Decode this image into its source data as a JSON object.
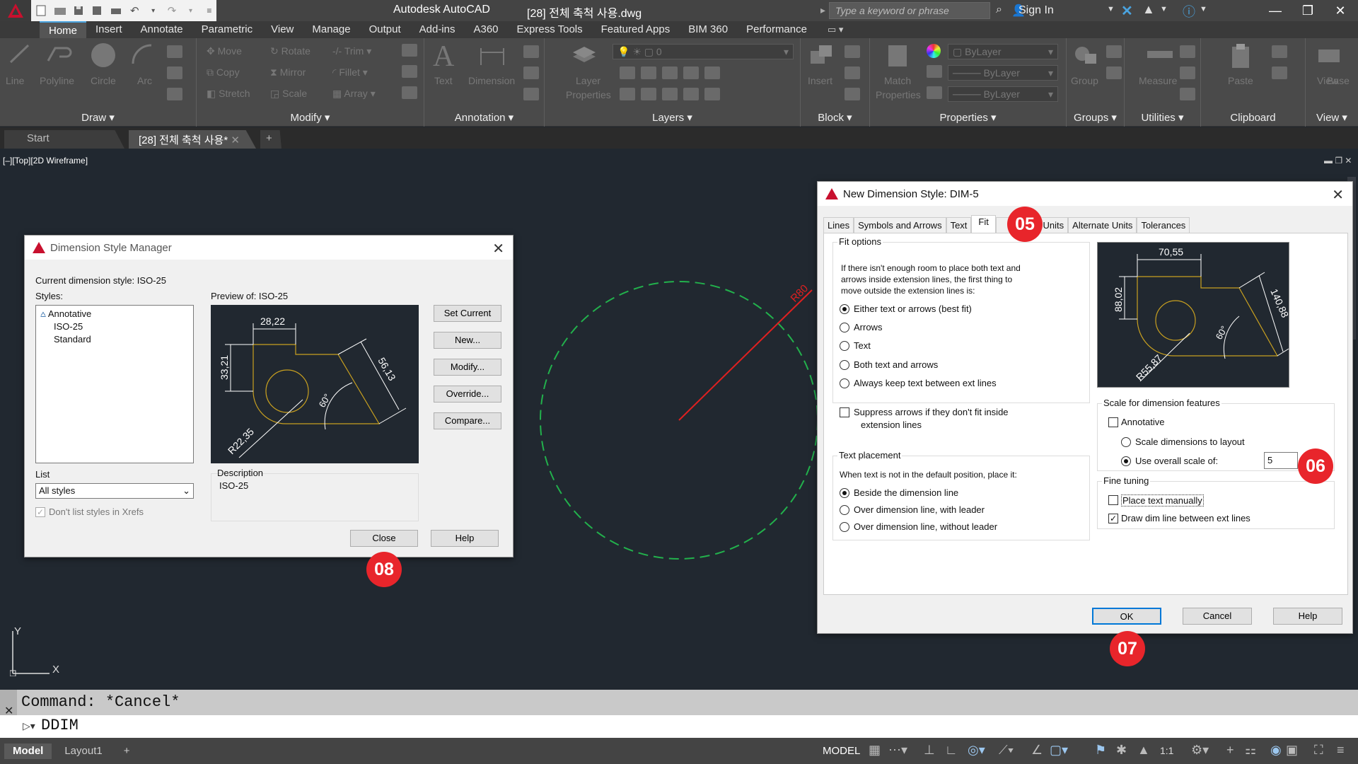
{
  "titlebar": {
    "app_name": "Autodesk AutoCAD",
    "file_name": "[28] 전체 축척 사용.dwg",
    "search_placeholder": "Type a keyword or phrase",
    "sign_in": "Sign In"
  },
  "ribbon_tabs": [
    "Home",
    "Insert",
    "Annotate",
    "Parametric",
    "View",
    "Manage",
    "Output",
    "Add-ins",
    "A360",
    "Express Tools",
    "Featured Apps",
    "BIM 360",
    "Performance"
  ],
  "ribbon": {
    "draw": {
      "title": "Draw",
      "line": "Line",
      "polyline": "Polyline",
      "circle": "Circle",
      "arc": "Arc"
    },
    "modify": {
      "title": "Modify",
      "move": "Move",
      "rotate": "Rotate",
      "trim": "Trim",
      "copy": "Copy",
      "mirror": "Mirror",
      "fillet": "Fillet",
      "stretch": "Stretch",
      "scale": "Scale",
      "array": "Array"
    },
    "annotation": {
      "title": "Annotation",
      "text": "Text",
      "dimension": "Dimension"
    },
    "layers": {
      "title": "Layers",
      "layer_properties_1": "Layer",
      "layer_properties_2": "Properties",
      "current_layer": "0"
    },
    "block": {
      "title": "Block",
      "insert": "Insert"
    },
    "properties": {
      "title": "Properties",
      "match_1": "Match",
      "match_2": "Properties",
      "color": "ByLayer",
      "linetype": "ByLayer",
      "lineweight": "ByLayer"
    },
    "groups": {
      "title": "Groups",
      "group": "Group"
    },
    "utilities": {
      "title": "Utilities",
      "measure": "Measure"
    },
    "clipboard": {
      "title": "Clipboard",
      "paste": "Paste"
    },
    "view": {
      "title": "View",
      "base": "Base"
    }
  },
  "doc_tabs": {
    "start": "Start",
    "active": "[28] 전체 축척 사용*"
  },
  "viewport": {
    "label": "[–][Top][2D Wireframe]",
    "radius_label": "R80",
    "axis_y": "Y",
    "axis_x": "X"
  },
  "dsm": {
    "title": "Dimension Style Manager",
    "current": "Current dimension style: ISO-25",
    "styles_label": "Styles:",
    "styles": [
      "Annotative",
      "ISO-25",
      "Standard"
    ],
    "preview_label": "Preview of: ISO-25",
    "preview": {
      "d1": "28,22",
      "d2": "33,21",
      "d3": "56,13",
      "angle": "60°",
      "radius": "R22,35"
    },
    "buttons": {
      "set_current": "Set Current",
      "new": "New...",
      "modify": "Modify...",
      "override": "Override...",
      "compare": "Compare...",
      "close": "Close",
      "help": "Help"
    },
    "list_label": "List",
    "list_value": "All styles",
    "xrefs": "Don't list styles in Xrefs",
    "description_label": "Description",
    "description_value": "ISO-25"
  },
  "nds": {
    "title": "New Dimension Style: DIM-5",
    "tabs": [
      "Lines",
      "Symbols and Arrows",
      "Text",
      "Fit",
      "ary Units",
      "Alternate Units",
      "Tolerances"
    ],
    "fit_options": {
      "title": "Fit options",
      "desc_1": "If there isn't enough room to place both text and",
      "desc_2": "arrows inside extension lines, the first thing to",
      "desc_3": "move outside the extension lines is:",
      "either": "Either text or arrows (best fit)",
      "arrows": "Arrows",
      "text": "Text",
      "both": "Both text and arrows",
      "always": "Always keep text between ext lines",
      "suppress_1": "Suppress arrows if they don't fit inside",
      "suppress_2": "extension lines"
    },
    "text_placement": {
      "title": "Text placement",
      "desc": "When text is not in the default position, place it:",
      "beside": "Beside the dimension line",
      "over_leader": "Over dimension line, with leader",
      "over_no_leader": "Over dimension line, without leader"
    },
    "preview": {
      "d1": "70,55",
      "d2": "88,02",
      "d3": "140,88",
      "angle": "60°",
      "radius": "R55,87"
    },
    "scale": {
      "title": "Scale for dimension features",
      "annotative": "Annotative",
      "to_layout": "Scale dimensions to layout",
      "overall": "Use overall scale of:",
      "overall_value": "5"
    },
    "fine_tuning": {
      "title": "Fine tuning",
      "manual": "Place text manually",
      "draw_dim": "Draw dim line between ext lines"
    },
    "buttons": {
      "ok": "OK",
      "cancel": "Cancel",
      "help": "Help"
    }
  },
  "markers": {
    "m05": "05",
    "m06": "06",
    "m07": "07",
    "m08": "08"
  },
  "command": {
    "history": "Command: *Cancel*",
    "current": "DDIM"
  },
  "status": {
    "model_tab": "Model",
    "layout_tab": "Layout1",
    "model_label": "MODEL",
    "scale": "1:1"
  },
  "colors": {
    "marker": "#e8252b",
    "circle": "#22b14c",
    "radius_line": "#e02020",
    "preview_dim": "#ffffff",
    "preview_geom": "#c8a020"
  }
}
